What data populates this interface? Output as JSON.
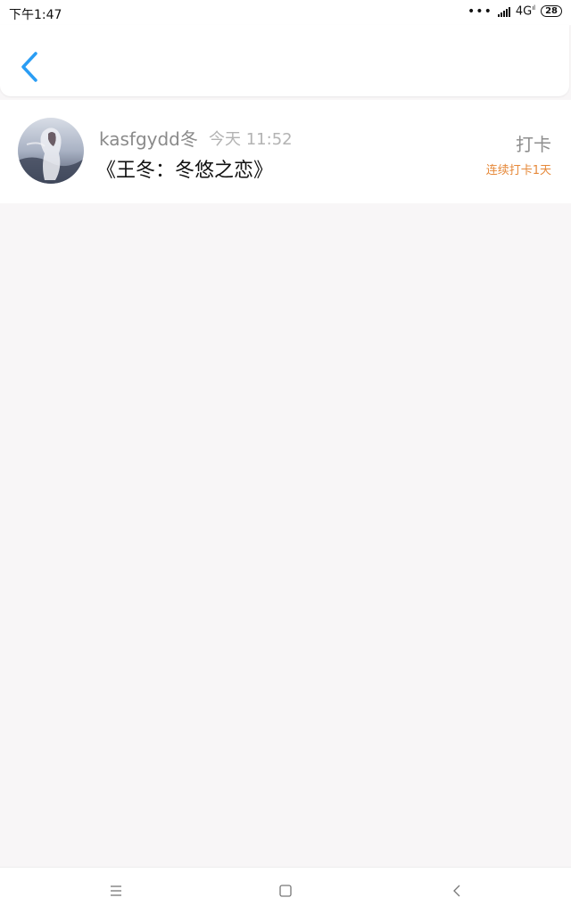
{
  "status": {
    "time": "下午1:47",
    "network": "4G",
    "battery": "28"
  },
  "header": {
    "back_icon": "chevron-left-icon",
    "accent": "#2a9df4"
  },
  "post": {
    "username": "kasfgydd冬",
    "timestamp": "今天 11:52",
    "title": "《王冬：冬悠之恋》",
    "action_label": "打卡",
    "streak": "连续打卡1天",
    "streak_color": "#e6893a"
  },
  "navbar": {
    "icons": [
      "menu-icon",
      "home-square-icon",
      "back-triangle-icon"
    ]
  }
}
